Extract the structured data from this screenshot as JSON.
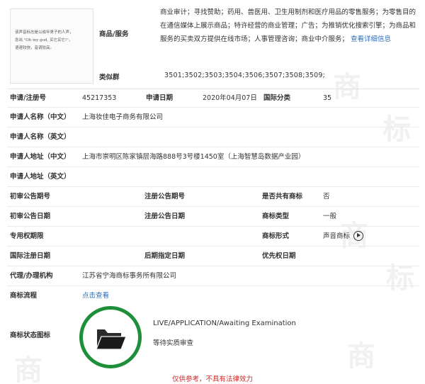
{
  "thumbnail": {
    "lines": [
      "该声音标志是以成年男子的人声，",
      "念出 \"Oh my god, 买它买它!\"，",
      "语速较快，音调较高。"
    ]
  },
  "goods": {
    "label": "商品/服务",
    "text": "商业审计；寻找赞助；药用、兽医用、卫生用制剂和医疗用品的零售服务；为零售目的在通信媒体上展示商品；特许经营的商业管理；广告；为推销优化搜索引擎；为商品和服务的买卖双方提供在线市场；人事管理咨询；商业中介服务；",
    "more_link": "查看详细信息"
  },
  "similar_group": {
    "label": "类似群",
    "value": "3501;3502;3503;3504;3506;3507;3508;3509;"
  },
  "reg_no": {
    "label": "申请/注册号",
    "value": "45217353"
  },
  "app_date": {
    "label": "申请日期",
    "value": "2020年04月07日"
  },
  "intl_class": {
    "label": "国际分类",
    "value": "35"
  },
  "applicant_cn": {
    "label": "申请人名称（中文）",
    "value": "上海妆佳电子商务有限公司"
  },
  "applicant_en": {
    "label": "申请人名称（英文）",
    "value": ""
  },
  "address_cn": {
    "label": "申请人地址（中文）",
    "value": "上海市崇明区陈家镇层海路888号3号楼1450室（上海智慧岛数据产业园）"
  },
  "address_en": {
    "label": "申请人地址（英文）",
    "value": ""
  },
  "prelim_pub_no": {
    "label": "初审公告期号",
    "value": ""
  },
  "reg_pub_no": {
    "label": "注册公告期号",
    "value": ""
  },
  "shared": {
    "label": "是否共有商标",
    "value": "否"
  },
  "prelim_pub_date": {
    "label": "初审公告日期",
    "value": ""
  },
  "reg_pub_date": {
    "label": "注册公告日期",
    "value": ""
  },
  "tm_type": {
    "label": "商标类型",
    "value": "一般"
  },
  "exclusive_period": {
    "label": "专用权期限",
    "value": ""
  },
  "tm_form": {
    "label": "商标形式",
    "value": "声音商标"
  },
  "intl_reg_date": {
    "label": "国际注册日期",
    "value": ""
  },
  "later_date": {
    "label": "后期指定日期",
    "value": ""
  },
  "priority_date": {
    "label": "优先权日期",
    "value": ""
  },
  "agent": {
    "label": "代理/办理机构",
    "value": "江苏省宁海商标事务所有限公司"
  },
  "process": {
    "label": "商标流程",
    "link": "点击查看"
  },
  "status": {
    "label": "商标状态图标",
    "en": "LIVE/APPLICATION/Awaiting Examination",
    "cn": "等待实质审查",
    "ring_color": "#1f8f3a",
    "icon": "folder-open-icon"
  },
  "disclaimer": "仅供参考，不具有法律效力",
  "colors": {
    "link": "#2a6ebf",
    "disclaimer": "#d12a2a",
    "status_ring": "#1f8f3a"
  }
}
